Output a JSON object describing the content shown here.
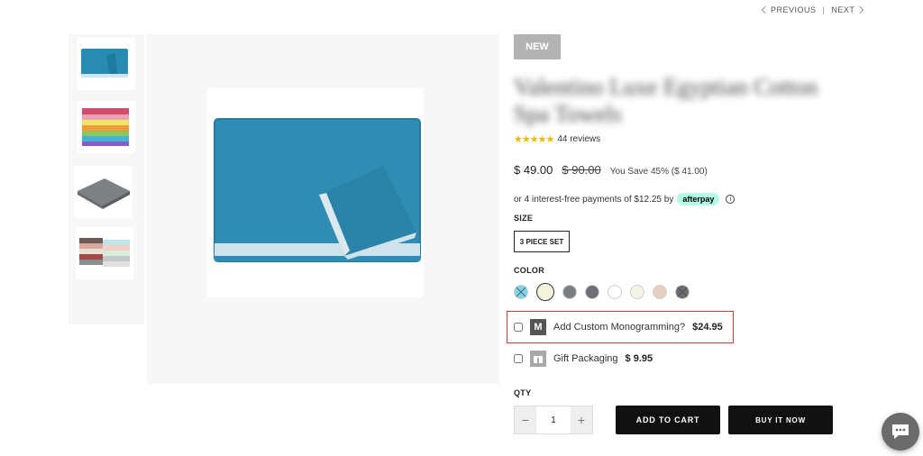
{
  "nav": {
    "prev_label": "PREVIOUS",
    "separator": "|",
    "next_label": "NEXT"
  },
  "product": {
    "badge": "NEW",
    "title": "Valentino Luxe Egyptian Cotton Spa Towels",
    "stars": "★★★★★",
    "reviews": "44 reviews",
    "price": "$ 49.00",
    "compare_price": "$ 90.00",
    "savings": "You Save 45% ($ 41.00)"
  },
  "afterpay": {
    "text": "or 4 interest-free payments of $12.25 by",
    "logo": "afterpay",
    "info_icon": "info-icon"
  },
  "size": {
    "label": "SIZE",
    "options": [
      "3 PIECE SET"
    ]
  },
  "color": {
    "label": "COLOR",
    "swatches": [
      {
        "name": "aqua",
        "color": "#7fd3e6",
        "unavailable": true
      },
      {
        "name": "ivory",
        "color": "#f3f3dc",
        "selected": true
      },
      {
        "name": "gray",
        "color": "#7a7d82"
      },
      {
        "name": "charcoal",
        "color": "#6e7075"
      },
      {
        "name": "white",
        "color": "#ffffff"
      },
      {
        "name": "cream",
        "color": "#f6f4e4"
      },
      {
        "name": "blush",
        "color": "#e7cfc2"
      },
      {
        "name": "slate",
        "color": "#6b6d70",
        "unavailable": true
      }
    ]
  },
  "options": {
    "monogram": {
      "icon": "M",
      "label": "Add Custom Monogramming?",
      "price": "$24.95"
    },
    "gift": {
      "label": "Gift Packaging",
      "price": "$ 9.95"
    }
  },
  "qty": {
    "label": "QTY",
    "value": "1",
    "minus": "−",
    "plus": "+"
  },
  "buttons": {
    "add_to_cart": "ADD TO CART",
    "buy_now": "BUY IT NOW"
  },
  "colors": {
    "accent": "#111111",
    "highlight_border": "#e03838",
    "star": "#f5b800"
  }
}
